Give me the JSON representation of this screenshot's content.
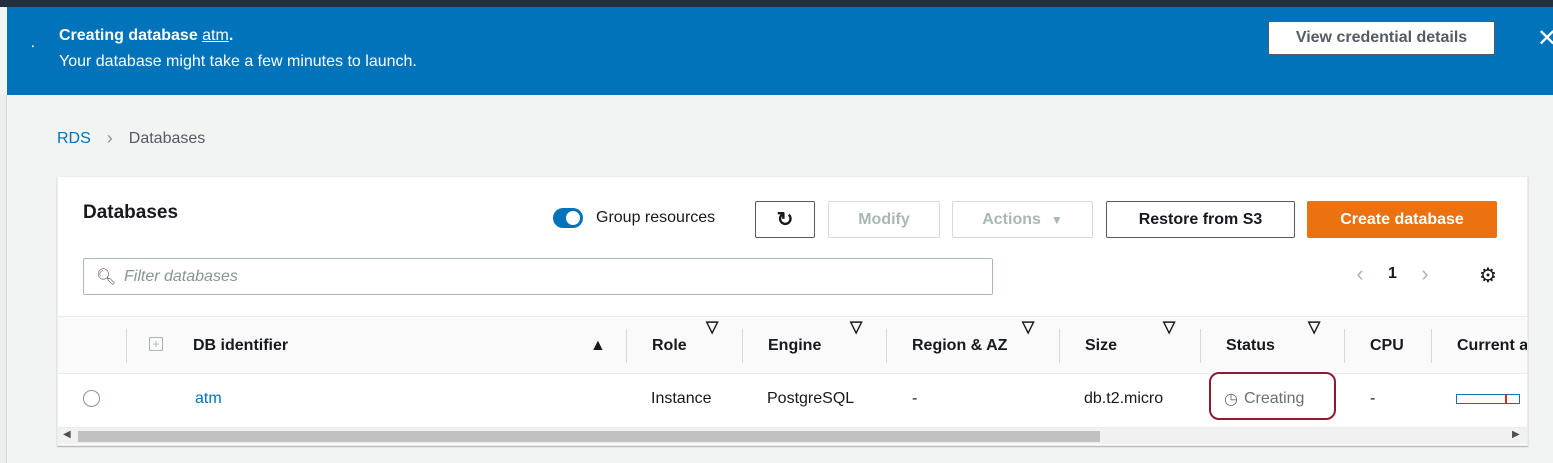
{
  "banner": {
    "title_prefix": "Creating database ",
    "db_link": "atm",
    "title_suffix": ".",
    "subtitle": "Your database might take a few minutes to launch.",
    "view_credentials_label": "View credential details",
    "close_icon": "close-icon",
    "color": "#0073bb"
  },
  "breadcrumb": {
    "root": "RDS",
    "current": "Databases"
  },
  "panel": {
    "title": "Databases",
    "group_resources_label": "Group resources",
    "group_resources_on": true,
    "modify_label": "Modify",
    "actions_label": "Actions",
    "restore_label": "Restore from S3",
    "create_label": "Create database",
    "search_placeholder": "Filter databases",
    "page_number": "1"
  },
  "table": {
    "columns": {
      "db_identifier": "DB identifier",
      "role": "Role",
      "engine": "Engine",
      "region": "Region & AZ",
      "size": "Size",
      "status": "Status",
      "cpu": "CPU",
      "current": "Current a"
    },
    "rows": [
      {
        "db_identifier": "atm",
        "role": "Instance",
        "engine": "PostgreSQL",
        "region": "-",
        "size": "db.t2.micro",
        "status": "Creating",
        "cpu": "-"
      }
    ]
  },
  "colors": {
    "primary": "#ec7211",
    "link": "#0073bb"
  }
}
